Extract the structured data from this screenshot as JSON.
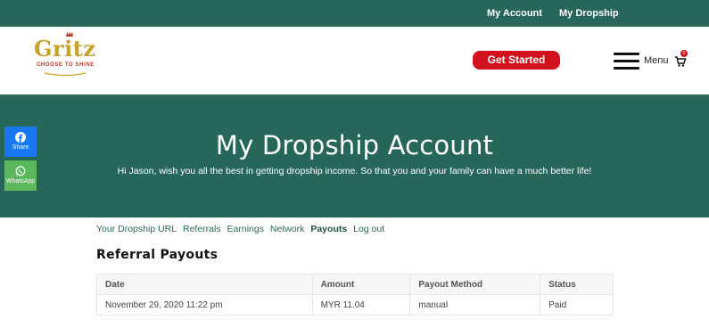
{
  "topbar": {
    "links": [
      "My Account",
      "My Dropship"
    ]
  },
  "header": {
    "logo": {
      "word": "Gritz",
      "tagline": "CHOOSE TO SHINE"
    },
    "cta_label": "Get Started",
    "menu_label": "Menu",
    "cart_count": "0"
  },
  "hero": {
    "title": "My Dropship Account",
    "subtitle": "Hi Jason, wish you all the best in getting dropship income. So that you and your family can have a much better life!"
  },
  "share": {
    "facebook_label": "Share",
    "whatsapp_label": "WhatsApp"
  },
  "tabs": [
    {
      "label": "Your Dropship URL",
      "active": false
    },
    {
      "label": "Referrals",
      "active": false
    },
    {
      "label": "Earnings",
      "active": false
    },
    {
      "label": "Network",
      "active": false
    },
    {
      "label": "Payouts",
      "active": true
    },
    {
      "label": "Log out",
      "active": false
    }
  ],
  "section_title": "Referral Payouts",
  "payouts_table": {
    "headers": [
      "Date",
      "Amount",
      "Payout Method",
      "Status"
    ],
    "rows": [
      [
        "November 29, 2020 11:22 pm",
        "MYR 11.04",
        "manual",
        "Paid"
      ]
    ]
  },
  "colors": {
    "brand_green": "#27675a",
    "cta_red": "#d1121c",
    "logo_gold": "#c9a227",
    "facebook_blue": "#1877f2",
    "whatsapp_green": "#5cb85c"
  }
}
